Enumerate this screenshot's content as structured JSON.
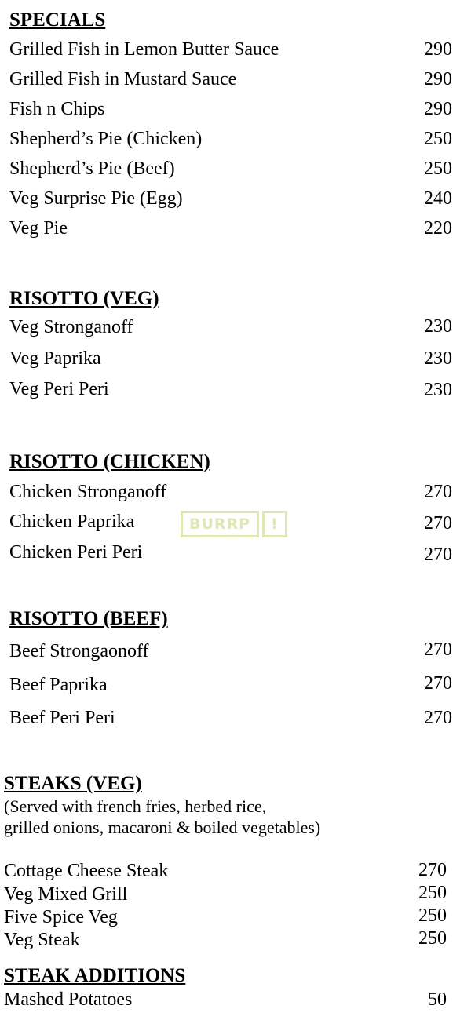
{
  "sections": {
    "specials": {
      "heading": "SPECIALS",
      "items": [
        {
          "name": "Grilled Fish in Lemon Butter Sauce",
          "price": "290"
        },
        {
          "name": "Grilled Fish in Mustard Sauce",
          "price": "290"
        },
        {
          "name": "Fish n Chips",
          "price": "290"
        },
        {
          "name": "Shepherd’s Pie (Chicken)",
          "price": "250"
        },
        {
          "name": "Shepherd’s Pie (Beef)",
          "price": "250"
        },
        {
          "name": "Veg Surprise Pie (Egg)",
          "price": "240"
        },
        {
          "name": "Veg Pie",
          "price": "220"
        }
      ]
    },
    "risotto_veg": {
      "heading": "RISOTTO (VEG)",
      "items": [
        {
          "name": "Veg Stronganoff",
          "price": "230"
        },
        {
          "name": "Veg Paprika",
          "price": "230"
        },
        {
          "name": "Veg Peri Peri",
          "price": "230"
        }
      ]
    },
    "risotto_chicken": {
      "heading": "RISOTTO (CHICKEN)",
      "items": [
        {
          "name": "Chicken Stronganoff",
          "price": "270"
        },
        {
          "name": "Chicken Paprika",
          "price": "270"
        },
        {
          "name": "Chicken Peri Peri",
          "price": "270"
        }
      ]
    },
    "risotto_beef": {
      "heading": "RISOTTO (BEEF)",
      "items": [
        {
          "name": "Beef Strongaonoff",
          "price": "270"
        },
        {
          "name": "Beef Paprika",
          "price": "270"
        },
        {
          "name": "Beef Peri Peri",
          "price": "270"
        }
      ]
    },
    "steaks_veg": {
      "heading": "STEAKS (VEG)",
      "note_line1": "(Served with french fries, herbed rice,",
      "note_line2": "grilled onions, macaroni & boiled vegetables)",
      "items": [
        {
          "name": "Cottage Cheese Steak",
          "price": "270"
        },
        {
          "name": "Veg Mixed Grill",
          "price": "250"
        },
        {
          "name": "Five Spice Veg",
          "price": "250"
        },
        {
          "name": "Veg Steak",
          "price": "250"
        }
      ]
    },
    "steak_additions": {
      "heading": "STEAK ADDITIONS",
      "items": [
        {
          "name": "Mashed Potatoes",
          "price": "50"
        }
      ]
    }
  },
  "watermark": {
    "word": "BURRP",
    "mark": "!",
    "color": "#dde8b4"
  }
}
